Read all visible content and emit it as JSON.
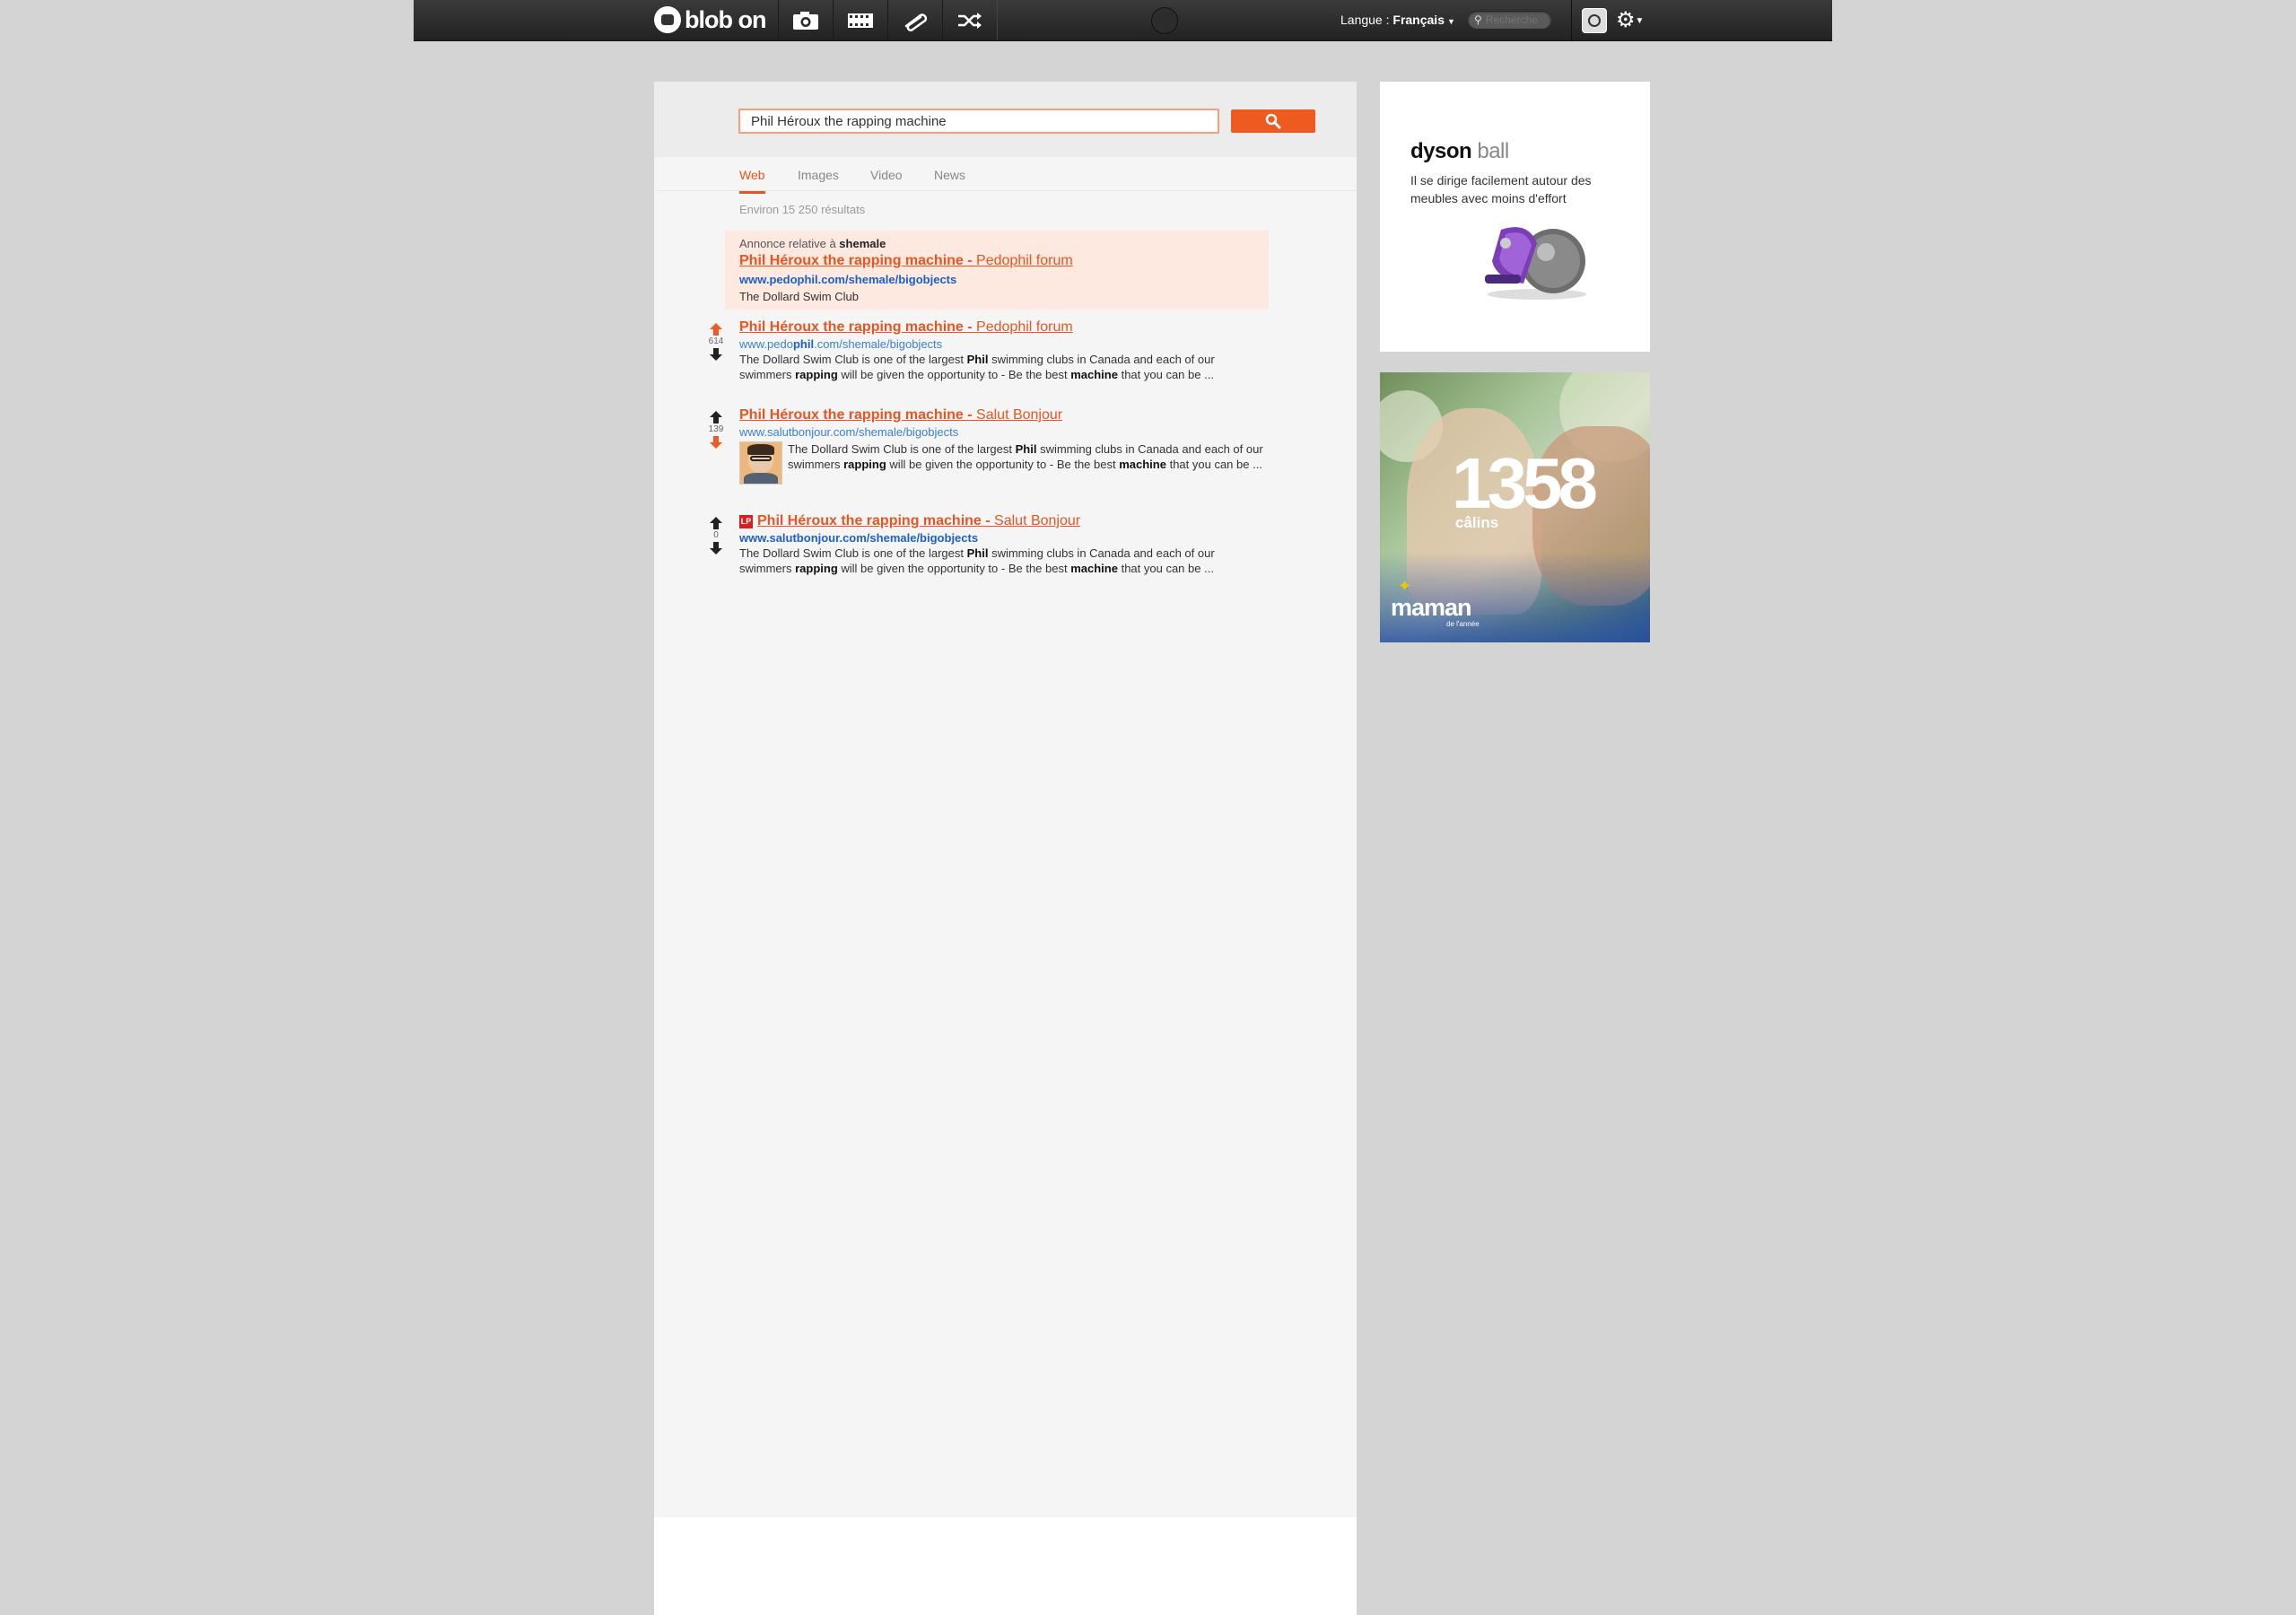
{
  "topbar": {
    "logo_text": "blob on",
    "language_label": "Langue :",
    "language_value": "Français",
    "search_placeholder": "Recherche"
  },
  "search": {
    "query": "Phil Héroux the rapping machine"
  },
  "tabs": [
    {
      "label": "Web",
      "active": true
    },
    {
      "label": "Images",
      "active": false
    },
    {
      "label": "Video",
      "active": false
    },
    {
      "label": "News",
      "active": false
    }
  ],
  "result_count": "Environ 15 250 résultats",
  "ad": {
    "label_prefix": "Annonce relative à ",
    "label_term": "shemale",
    "title": "Phil Héroux the rapping machine - ",
    "site": "Pedophil forum",
    "url": "www.pedophil.com/shemale/bigobjects",
    "description": "The Dollard Swim Club"
  },
  "results": [
    {
      "votes": "614",
      "title": "Phil Héroux the rapping machine - ",
      "site": "Pedophil forum",
      "url_prefix": "www.pedo",
      "url_bold": "phil",
      "url_suffix": ".com/shemale/bigobjects",
      "desc": {
        "a": "The Dollard Swim Club is one of the largest ",
        "b1": "Phil",
        "c": " swimming clubs in Canada and each of our swimmers ",
        "b2": "rapping",
        "d": " will be given the opportunity to - Be the best ",
        "b3": "machine",
        "e": " that you can be ..."
      }
    },
    {
      "votes": "139",
      "title": "Phil Héroux the rapping machine - ",
      "site": "Salut Bonjour",
      "url": "www.salutbonjour.com/shemale/bigobjects",
      "desc": {
        "a": "The Dollard Swim Club is one of the largest ",
        "b1": "Phil",
        "c": " swimming clubs in Canada and each of our swimmers ",
        "b2": "rapping",
        "d": " will be given the opportunity to - Be the best ",
        "b3": "machine",
        "e": " that you can be ..."
      }
    },
    {
      "votes": "0",
      "favicon_text": "LP",
      "title": "Phil Héroux the rapping machine - ",
      "site": "Salut Bonjour",
      "url": "www.salutbonjour.com/shemale/bigobjects",
      "desc": {
        "a": "The Dollard Swim Club is one of the largest ",
        "b1": "Phil",
        "c": " swimming clubs in Canada and each of our swimmers ",
        "b2": "rapping",
        "d": " will be given the opportunity to - Be the best ",
        "b3": "machine",
        "e": " that you can be ..."
      }
    }
  ],
  "ads_sidebar": {
    "dyson": {
      "brand": "dyson",
      "product": "ball",
      "text": "Il se dirige facilement autour des meubles avec moins d'effort"
    },
    "maman": {
      "number": "1358",
      "word": "câlins",
      "logo": "maman",
      "sub": "de l'année"
    }
  },
  "colors": {
    "accent": "#e8551e",
    "link_blue": "#3a7fd5",
    "vote_up_active": "#ee5a20",
    "topbar": "#2a2a2a"
  }
}
